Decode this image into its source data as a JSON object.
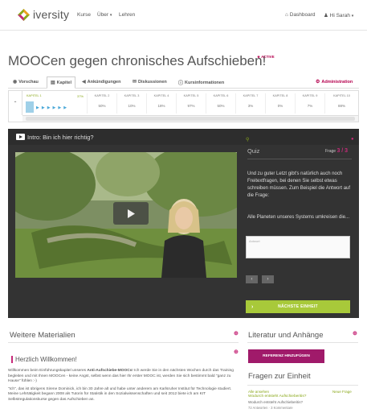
{
  "header": {
    "brand": "iversity",
    "nav": [
      "Kurse",
      "Über",
      "Lehren"
    ],
    "dashboard": "Dashboard",
    "user": "Hi Sarah",
    "brand_color": "#8aa81a"
  },
  "course": {
    "title": "MOOCen gegen chronisches Aufschieben!",
    "status": "ACTIVE"
  },
  "tabs": [
    {
      "label": "Vorschau",
      "icon": "eye-icon"
    },
    {
      "label": "Kapitel",
      "icon": "film-icon",
      "selected": true
    },
    {
      "label": "Ankündigungen",
      "icon": "megaphone-icon"
    },
    {
      "label": "Diskussionen",
      "icon": "chat-icon"
    },
    {
      "label": "Kursinformationen",
      "icon": "info-icon"
    },
    {
      "label": "Administration",
      "icon": "gear-icon"
    }
  ],
  "chapters": {
    "first": {
      "name": "KAPITEL 1",
      "percent": "37%"
    },
    "items": [
      {
        "name": "KAPITEL 2",
        "percent": "50%"
      },
      {
        "name": "KAPITEL 3",
        "percent": "10%"
      },
      {
        "name": "KAPITEL 4",
        "percent": "18%"
      },
      {
        "name": "KAPITEL 5",
        "percent": "97%"
      },
      {
        "name": "KAPITEL 6",
        "percent": "50%"
      },
      {
        "name": "KAPITEL 7",
        "percent": "3%"
      },
      {
        "name": "KAPITEL 8",
        "percent": "0%"
      },
      {
        "name": "KAPITEL 9",
        "percent": "7%"
      },
      {
        "name": "KAPITEL 10",
        "percent": "88%"
      }
    ]
  },
  "player": {
    "title": "Intro: Bin ich hier richtig?"
  },
  "quiz": {
    "label": "Quiz",
    "page_word": "Frage",
    "page": "3 / 3",
    "text": "Und zu guter Letzt gibt's natürlich auch noch Freitextfragen, bei denen Sie selbst etwas schreiben müssen. Zum Beispiel die Antwort auf die Frage:",
    "question": "Alle Planeten unseres Systems umkreisen die...",
    "answer_placeholder": "Antwort",
    "next_unit": "NÄCHSTE EINHEIT"
  },
  "materials": {
    "title": "Weitere Materialien",
    "welcome_title": "Herzlich Willkommen!",
    "p1_start": "Willkommen beim Einführungskapitel unseres ",
    "p1_bold": "Anti-Aufschiebe-MOOCs",
    "p1_end": "! Ich werde Sie in den nächsten Wochen durch das Training begleiten und mit Ihnen MOOCen - keine Angst, selbst wenn das hier Ihr erster MOOC ist, werden Sie sich bestimmt bald \"ganz zu Hause\" fühlen :-)",
    "p2": "\"Ich\", das ist übrigens Sirene Dominick, ich bin 30 Jahre alt und habe unter anderem am Karlsruher Institut für Technologie studiert. Meine Lehrtätigkeit begann 2008 als Tutorin für Statistik in den Sozialwissenschaften und seit 2012 biete ich am KIT Selbstregulationskurse gegen das Aufschieben an."
  },
  "literature": {
    "title": "Literatur und Anhänge",
    "add_reference": "REFERENZ HINZUFÜGEN"
  },
  "questions": {
    "title": "Fragen zur Einheit",
    "all": "Alle ansehen",
    "new": "Neue Frage",
    "item_title": "Wodurch entsteht Aufschieberitis?",
    "item_sub": "Wodurch entsteht Aufschieberitis?",
    "item_meta": "72 Antworten · 3 Kommentare"
  }
}
